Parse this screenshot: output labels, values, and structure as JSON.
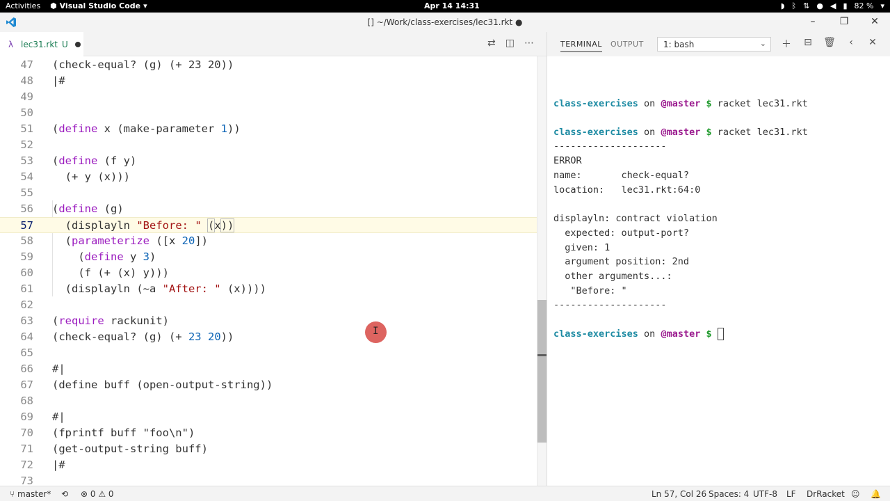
{
  "topbar": {
    "activities": "Activities",
    "app_name": "Visual Studio Code",
    "clock": "Apr 14  14:31",
    "battery": "82 %"
  },
  "window": {
    "title": "[] ~/Work/class-exercises/lec31.rkt ●"
  },
  "editor": {
    "tab": {
      "name": "lec31.rkt",
      "status": "U"
    },
    "lines": [
      {
        "n": "47"
      },
      {
        "n": "48"
      },
      {
        "n": "49"
      },
      {
        "n": "50"
      },
      {
        "n": "51"
      },
      {
        "n": "52"
      },
      {
        "n": "53"
      },
      {
        "n": "54"
      },
      {
        "n": "55"
      },
      {
        "n": "56"
      },
      {
        "n": "57"
      },
      {
        "n": "58"
      },
      {
        "n": "59"
      },
      {
        "n": "60"
      },
      {
        "n": "61"
      },
      {
        "n": "62"
      },
      {
        "n": "63"
      },
      {
        "n": "64"
      },
      {
        "n": "65"
      },
      {
        "n": "66"
      },
      {
        "n": "67"
      },
      {
        "n": "68"
      },
      {
        "n": "69"
      },
      {
        "n": "70"
      },
      {
        "n": "71"
      },
      {
        "n": "72"
      },
      {
        "n": "73"
      }
    ],
    "code": {
      "l47": "(check-equal? (g) (+ 23 20))",
      "l48": "|#",
      "l51a": "(",
      "l51b": "define",
      "l51c": " x (make-parameter ",
      "l51d": "1",
      "l51e": "))",
      "l53a": "(",
      "l53b": "define",
      "l53c": " (f y)",
      "l54": "  (+ y (x)))",
      "l56a": "(",
      "l56b": "define",
      "l56c": " (g)",
      "l57a": "  (displayln ",
      "l57b": "\"Before: \"",
      "l57c": " ",
      "l57d": "(",
      "l57e": "x",
      "l57f": "))",
      "l58a": "  (",
      "l58b": "parameterize",
      "l58c": " ([x ",
      "l58d": "20",
      "l58e": "])",
      "l59a": "    (",
      "l59b": "define",
      "l59c": " y ",
      "l59d": "3",
      "l59e": ")",
      "l60": "    (f (+ (x) y)))",
      "l61a": "  (displayln (~a ",
      "l61b": "\"After: \"",
      "l61c": " (x))))",
      "l63a": "(",
      "l63b": "require",
      "l63c": " rackunit)",
      "l64a": "(check-equal? (g) (+ ",
      "l64b": "23",
      "l64c": " ",
      "l64d": "20",
      "l64e": "))",
      "l66": "#|",
      "l67": "(define buff (open-output-string))",
      "l69": "#|",
      "l70": "(fprintf buff \"foo\\n\")",
      "l71": "(get-output-string buff)",
      "l72": "|#"
    }
  },
  "panel": {
    "tab_terminal": "TERMINAL",
    "tab_output": "OUTPUT",
    "terminal_select": "1: bash",
    "terminal": {
      "prompt_dir": "class-exercises",
      "prompt_on": " on ",
      "prompt_branch": "@master",
      "prompt_dollar": " $ ",
      "cmd1": "racket lec31.rkt",
      "cmd2": "racket lec31.rkt",
      "rule": "--------------------",
      "error": "ERROR",
      "name_line": "name:       check-equal?",
      "location_line": "location:   lec31.rkt:64:0",
      "msg1": "displayln: contract violation",
      "msg2": "  expected: output-port?",
      "msg3": "  given: 1",
      "msg4": "  argument position: 2nd",
      "msg5": "  other arguments...:",
      "msg6": "   \"Before: \""
    }
  },
  "statusbar": {
    "branch": "master*",
    "errors": "0",
    "warnings": "0",
    "position": "Ln 57, Col 26",
    "spaces": "Spaces: 4",
    "encoding": "UTF-8",
    "eol": "LF",
    "language": "DrRacket"
  },
  "colors": {
    "keyword": "#9b1cbf",
    "number": "#0b63b5",
    "string": "#a31515",
    "prompt_dir": "#1e8ba3",
    "prompt_branch": "#9b1c8f",
    "prompt_dollar": "#1f9a2c"
  }
}
